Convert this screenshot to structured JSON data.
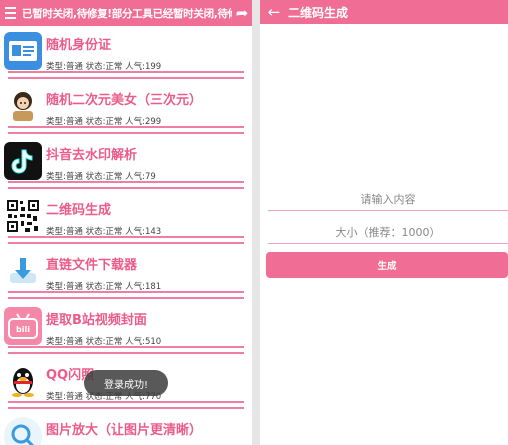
{
  "left": {
    "marquee": "已暂时关闭,待修复!部分工具已经暂时关闭,待修复!部分",
    "items": [
      {
        "title": "随机身份证",
        "meta": "类型:普通 状态:正常 人气:199",
        "icon": "id-card-icon"
      },
      {
        "title": "随机二次元美女（三次元）",
        "meta": "类型:普通 状态:正常 人气:299",
        "icon": "anime-girl-icon"
      },
      {
        "title": "抖音去水印解析",
        "meta": "类型:普通 状态:正常 人气:79",
        "icon": "tiktok-icon"
      },
      {
        "title": "二维码生成",
        "meta": "类型:普通 状态:正常 人气:143",
        "icon": "qr-code-icon"
      },
      {
        "title": "直链文件下载器",
        "meta": "类型:普通 状态:正常 人气:181",
        "icon": "download-icon"
      },
      {
        "title": "提取B站视频封面",
        "meta": "类型:普通 状态:正常 人气:510",
        "icon": "bilibili-icon"
      },
      {
        "title": "QQ闪照",
        "meta": "类型:普通 状态:正常 人气:770",
        "icon": "qq-penguin-icon"
      },
      {
        "title": "图片放大（让图片更清晰）",
        "meta": "",
        "icon": "image-enlarge-icon"
      }
    ],
    "toast": "登录成功!"
  },
  "right": {
    "title": "二维码生成",
    "content_placeholder": "请输入内容",
    "size_placeholder": "大小（推荐：1000）",
    "generate_label": "生成"
  },
  "colors": {
    "accent": "#f06d95",
    "title": "#ec5c8a",
    "divider": "#ee7ea2"
  }
}
